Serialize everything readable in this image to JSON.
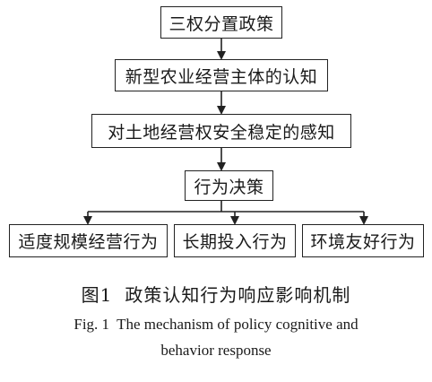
{
  "diagram": {
    "nodes": [
      {
        "id": "node1",
        "label": "三权分置政策"
      },
      {
        "id": "node2",
        "label": "新型农业经营主体的认知"
      },
      {
        "id": "node3",
        "label": "对土地经营权安全稳定的感知"
      },
      {
        "id": "node4",
        "label": "行为决策"
      },
      {
        "id": "node5",
        "label": "适度规模经营行为"
      },
      {
        "id": "node6",
        "label": "长期投入行为"
      },
      {
        "id": "node7",
        "label": "环境友好行为"
      }
    ],
    "edges": [
      {
        "from": "node1",
        "to": "node2"
      },
      {
        "from": "node2",
        "to": "node3"
      },
      {
        "from": "node3",
        "to": "node4"
      },
      {
        "from": "node4",
        "to": "node5"
      },
      {
        "from": "node4",
        "to": "node6"
      },
      {
        "from": "node4",
        "to": "node7"
      }
    ]
  },
  "caption": {
    "zh_number": "图1",
    "zh_title": "政策认知行为响应影响机制",
    "en_number": "Fig. 1",
    "en_title_line1": "The mechanism of policy cognitive and",
    "en_title_line2": "behavior response"
  }
}
